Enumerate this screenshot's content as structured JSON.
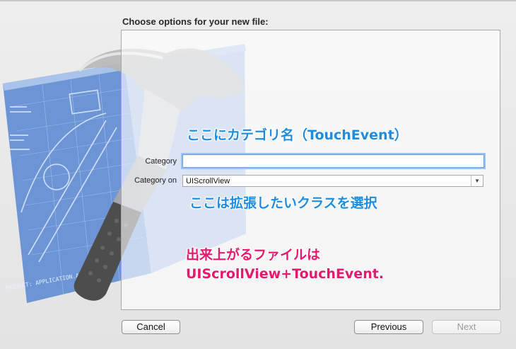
{
  "dialog": {
    "title": "Choose options for your new file:"
  },
  "form": {
    "category_label": "Category",
    "category_value": "",
    "category_on_label": "Category on",
    "category_on_value": "UIScrollView"
  },
  "annotations": {
    "category_hint": "ここにカテゴリ名（TouchEvent）",
    "class_hint": "ここは拡張したいクラスを選択",
    "result_line1": "出来上がるファイルは",
    "result_line2": "UIScrollView+TouchEvent."
  },
  "background_art": {
    "blueprint_text": "PROJECT: APPLICATION.APP"
  },
  "buttons": {
    "cancel": "Cancel",
    "previous": "Previous",
    "next": "Next"
  },
  "colors": {
    "hint_blue": "#1f8ce0",
    "result_pink": "#e8186f"
  }
}
